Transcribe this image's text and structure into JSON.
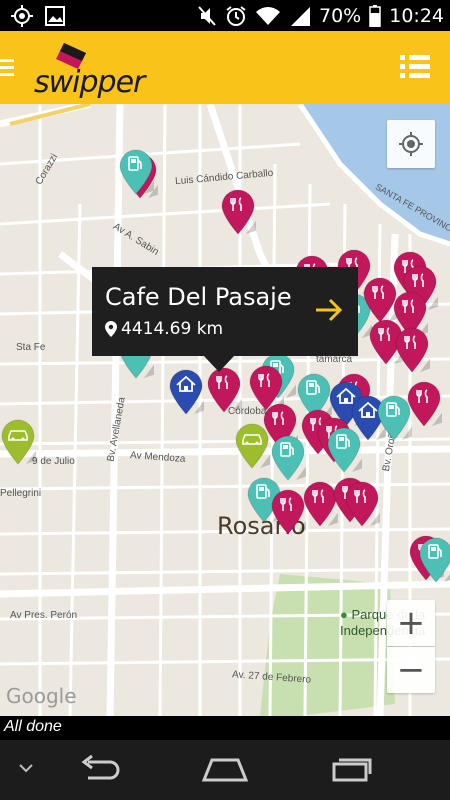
{
  "status_bar": {
    "battery": "70%",
    "time": "10:24",
    "icons": [
      "gps-icon",
      "image-icon",
      "mute-icon",
      "alarm-icon",
      "wifi-icon",
      "signal-icon",
      "battery-icon"
    ]
  },
  "app": {
    "logo_text": "swipper",
    "brand_color": "#f9c31a",
    "menu_icon": "menu-icon",
    "list_icon": "list-icon"
  },
  "map": {
    "streets": {
      "luis_candido": "Luis Cándido Carballo",
      "corazzi": "Corazzi",
      "av_sabin": "Av A. Sabin",
      "sta_fe": "Sta Fe",
      "cordoba": "Córdoba",
      "av_mendoza": "Av Mendoza",
      "nueve_julio": "9 de Julio",
      "pellegrini": "Pellegrini",
      "av_pres_peron": "Av Pres. Perón",
      "av_27_feb": "Av. 27 de Febrero",
      "bv_avellaneda": "Bv. Avellaneda",
      "bv_orono": "Bv. Oroño",
      "santa_fe_province": "SANTA FE PROVINCE",
      "tamarca": "tamarca"
    },
    "city": "Rosario",
    "park": [
      "Parque de la",
      "Independencia"
    ],
    "attribution": "Google",
    "zoom_in": "+",
    "zoom_out": "−",
    "pin_colors": {
      "restaurant": "#c2185b",
      "fuel": "#4dc0b5",
      "home": "#2a4bb0",
      "car": "#9cbd2c"
    }
  },
  "info_window": {
    "title": "Cafe Del Pasaje",
    "distance": "4414.69 km",
    "arrow_color": "#f9c31a"
  },
  "footer": {
    "status": "All done"
  },
  "navbar": {
    "buttons": [
      "hide-keyboard-icon",
      "back-icon",
      "home-icon",
      "recents-icon"
    ]
  }
}
